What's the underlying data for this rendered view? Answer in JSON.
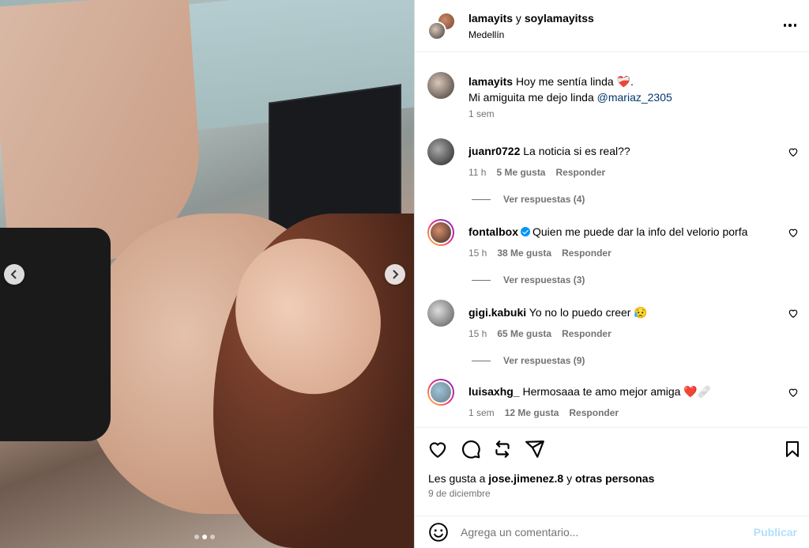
{
  "post": {
    "header": {
      "user1": "lamayits",
      "conj": " y ",
      "user2": "soylamayitss",
      "location": "Medellín"
    },
    "caption": {
      "user": "lamayits",
      "text1": "Hoy me sentía linda ",
      "emoji1": "❤️‍🩹",
      "text1_end": ".",
      "text2": "Mi amiguita me dejo linda ",
      "mention": "@mariaz_2305",
      "time": "1 sem"
    },
    "comments": [
      {
        "user": "juanr0722",
        "verified": false,
        "text": "La noticia si es real??",
        "time": "11 h",
        "likes": "5 Me gusta",
        "reply": "Responder",
        "replies": "Ver respuestas (4)"
      },
      {
        "user": "fontalbox",
        "verified": true,
        "text": "Quien me puede dar la info del velorio porfa",
        "time": "15 h",
        "likes": "38 Me gusta",
        "reply": "Responder",
        "replies": "Ver respuestas (3)"
      },
      {
        "user": "gigi.kabuki",
        "verified": false,
        "text": "Yo no lo puedo creer 😥",
        "time": "15 h",
        "likes": "65 Me gusta",
        "reply": "Responder",
        "replies": "Ver respuestas (9)"
      },
      {
        "user": "luisaxhg_",
        "verified": false,
        "text": "Hermosaaa te amo mejor amiga ❤️🩹",
        "time": "1 sem",
        "likes": "12 Me gusta",
        "reply": "Responder"
      }
    ],
    "likes_prefix": "Les gusta a ",
    "likes_user": "jose.jimenez.8",
    "likes_mid": " y ",
    "likes_others": "otras personas",
    "date": "9 de diciembre",
    "composer": {
      "placeholder": "Agrega un comentario...",
      "publish": "Publicar"
    }
  },
  "icons": [
    "chevron-left-icon",
    "chevron-right-icon",
    "more-icon",
    "heart-icon",
    "comment-icon",
    "repost-icon",
    "share-icon",
    "save-icon",
    "emoji-icon",
    "verified-icon"
  ]
}
